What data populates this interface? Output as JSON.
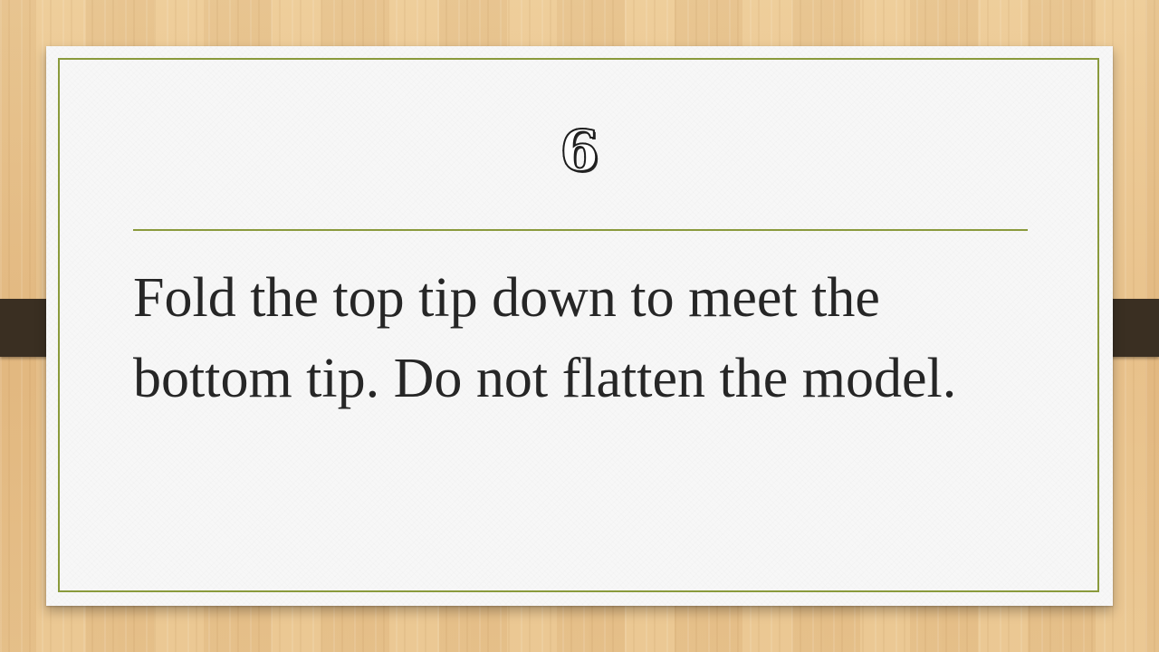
{
  "slide": {
    "title": "6",
    "body": "Fold the top tip down to meet the bottom tip. Do not flatten the model."
  },
  "colors": {
    "accent_line": "#8a9a3c",
    "text": "#262626",
    "paper": "#f7f7f7",
    "clip": "#3a2f22"
  }
}
